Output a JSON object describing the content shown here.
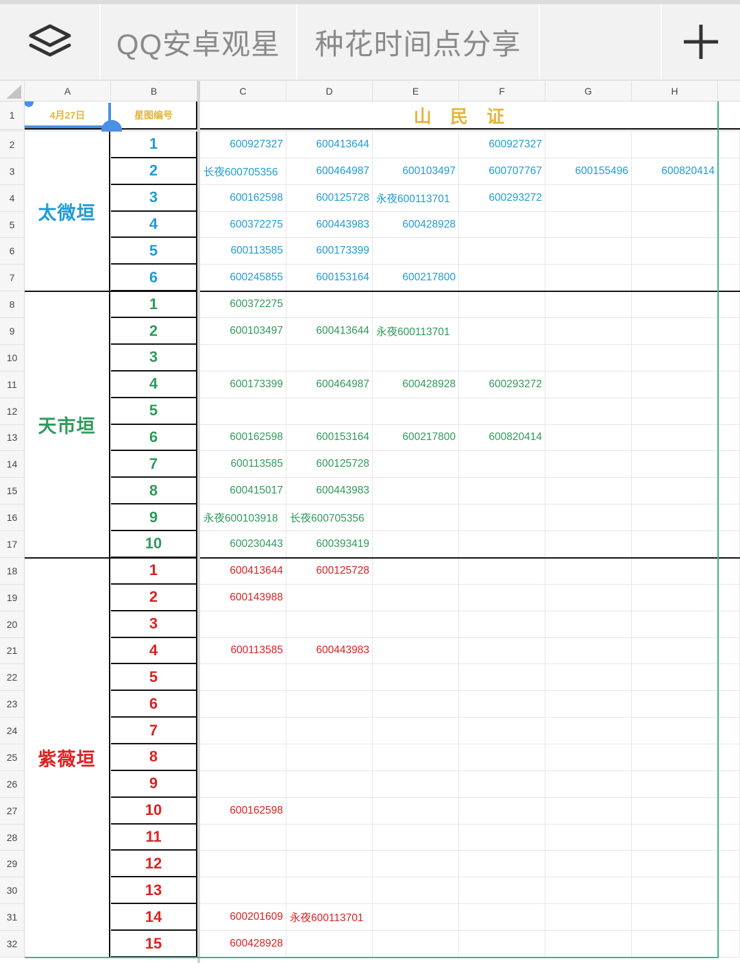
{
  "toolbar": {
    "menu_icon": "layers-icon",
    "tabs": [
      {
        "label": "QQ安卓观星"
      },
      {
        "label": "种花时间点分享"
      }
    ],
    "add_icon": "plus-icon"
  },
  "corner_icon": "select-all-triangle-icon",
  "columns": [
    "A",
    "B",
    "C",
    "D",
    "E",
    "F",
    "G",
    "H"
  ],
  "header": {
    "row_label": "1",
    "date": "4月27日",
    "chart_no": "星图编号",
    "title": "山 民 证"
  },
  "colors": {
    "header_yellow": "#e4b43c",
    "selection_blue": "#4a8fe3",
    "frame_teal": "#3ab38d",
    "toolbar_text": "#8a8a8a"
  },
  "groups": [
    {
      "name": "太微垣",
      "color": "#1f9bd7",
      "rows": [
        {
          "row": "2",
          "num": "1",
          "cells": [
            "600927327",
            "600413644",
            "",
            "600927327",
            "",
            ""
          ]
        },
        {
          "row": "3",
          "num": "2",
          "cells": [
            "长夜600705356",
            "600464987",
            "600103497",
            "600707767",
            "600155496",
            "600820414"
          ]
        },
        {
          "row": "4",
          "num": "3",
          "cells": [
            "600162598",
            "600125728",
            "永夜600113701",
            "600293272",
            "",
            ""
          ]
        },
        {
          "row": "5",
          "num": "4",
          "cells": [
            "600372275",
            "600443983",
            "600428928",
            "",
            "",
            ""
          ]
        },
        {
          "row": "6",
          "num": "5",
          "cells": [
            "600113585",
            "600173399",
            "",
            "",
            "",
            ""
          ]
        },
        {
          "row": "7",
          "num": "6",
          "cells": [
            "600245855",
            "600153164",
            "600217800",
            "",
            "",
            ""
          ]
        }
      ]
    },
    {
      "name": "天市垣",
      "color": "#2f9a5b",
      "rows": [
        {
          "row": "8",
          "num": "1",
          "cells": [
            "600372275",
            "",
            "",
            "",
            "",
            ""
          ]
        },
        {
          "row": "9",
          "num": "2",
          "cells": [
            "600103497",
            "600413644",
            "永夜600113701",
            "",
            "",
            ""
          ]
        },
        {
          "row": "10",
          "num": "3",
          "cells": [
            "",
            "",
            "",
            "",
            "",
            ""
          ]
        },
        {
          "row": "11",
          "num": "4",
          "cells": [
            "600173399",
            "600464987",
            "600428928",
            "600293272",
            "",
            ""
          ]
        },
        {
          "row": "12",
          "num": "5",
          "cells": [
            "",
            "",
            "",
            "",
            "",
            ""
          ]
        },
        {
          "row": "13",
          "num": "6",
          "cells": [
            "600162598",
            "600153164",
            "600217800",
            "600820414",
            "",
            ""
          ]
        },
        {
          "row": "14",
          "num": "7",
          "cells": [
            "600113585",
            "600125728",
            "",
            "",
            "",
            ""
          ]
        },
        {
          "row": "15",
          "num": "8",
          "cells": [
            "600415017",
            "600443983",
            "",
            "",
            "",
            ""
          ]
        },
        {
          "row": "16",
          "num": "9",
          "cells": [
            "永夜600103918",
            "长夜600705356",
            "",
            "",
            "",
            ""
          ]
        },
        {
          "row": "17",
          "num": "10",
          "cells": [
            "600230443",
            "600393419",
            "",
            "",
            "",
            ""
          ]
        }
      ]
    },
    {
      "name": "紫薇垣",
      "color": "#dc2121",
      "rows": [
        {
          "row": "18",
          "num": "1",
          "cells": [
            "600413644",
            "600125728",
            "",
            "",
            "",
            ""
          ]
        },
        {
          "row": "19",
          "num": "2",
          "cells": [
            "600143988",
            "",
            "",
            "",
            "",
            ""
          ]
        },
        {
          "row": "20",
          "num": "3",
          "cells": [
            "",
            "",
            "",
            "",
            "",
            ""
          ]
        },
        {
          "row": "21",
          "num": "4",
          "cells": [
            "600113585",
            "600443983",
            "",
            "",
            "",
            ""
          ]
        },
        {
          "row": "22",
          "num": "5",
          "cells": [
            "",
            "",
            "",
            "",
            "",
            ""
          ]
        },
        {
          "row": "23",
          "num": "6",
          "cells": [
            "",
            "",
            "",
            "",
            "",
            ""
          ]
        },
        {
          "row": "24",
          "num": "7",
          "cells": [
            "",
            "",
            "",
            "",
            "",
            ""
          ]
        },
        {
          "row": "25",
          "num": "8",
          "cells": [
            "",
            "",
            "",
            "",
            "",
            ""
          ]
        },
        {
          "row": "26",
          "num": "9",
          "cells": [
            "",
            "",
            "",
            "",
            "",
            ""
          ]
        },
        {
          "row": "27",
          "num": "10",
          "cells": [
            "600162598",
            "",
            "",
            "",
            "",
            ""
          ]
        },
        {
          "row": "28",
          "num": "11",
          "cells": [
            "",
            "",
            "",
            "",
            "",
            ""
          ]
        },
        {
          "row": "29",
          "num": "12",
          "cells": [
            "",
            "",
            "",
            "",
            "",
            ""
          ]
        },
        {
          "row": "30",
          "num": "13",
          "cells": [
            "",
            "",
            "",
            "",
            "",
            ""
          ]
        },
        {
          "row": "31",
          "num": "14",
          "cells": [
            "600201609",
            "永夜600113701",
            "",
            "",
            "",
            ""
          ]
        },
        {
          "row": "32",
          "num": "15",
          "cells": [
            "600428928",
            "",
            "",
            "",
            "",
            ""
          ]
        }
      ]
    }
  ]
}
